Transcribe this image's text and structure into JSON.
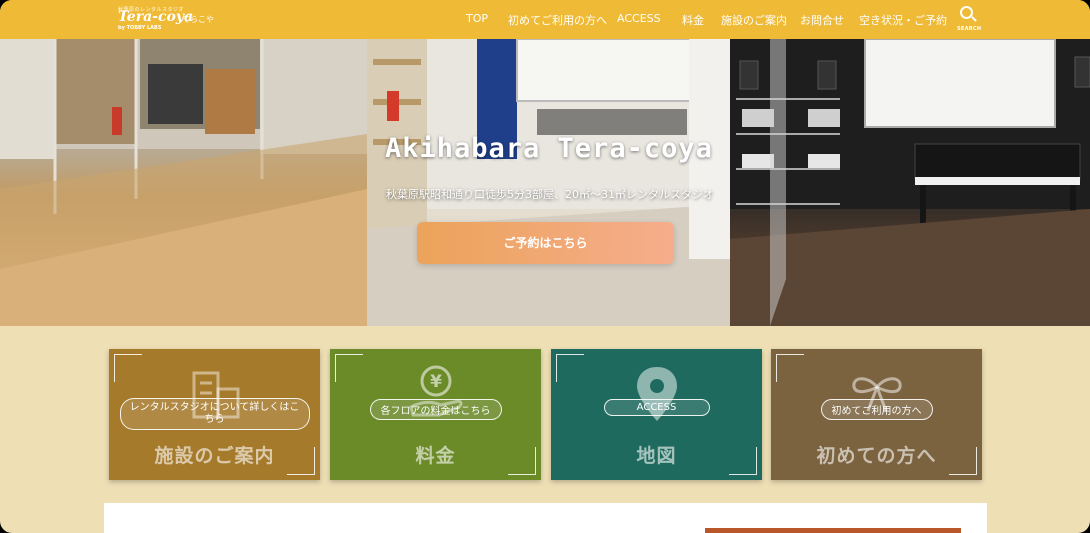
{
  "header": {
    "logo": {
      "tagline": "秋葉原のレンタルスタジオ",
      "name": "Tera-coya",
      "kana": "てらこや",
      "sub": "by TOBBY LABS"
    },
    "nav": [
      "TOP",
      "初めてご利用の方へ",
      "ACCESS",
      "料金",
      "施設のご案内",
      "お問合せ",
      "空き状況・ご予約"
    ],
    "search_label": "SEARCH"
  },
  "hero": {
    "title": "Akihabara Tera-coya",
    "subtitle": "秋葉原駅昭和通り口徒歩5分3部屋、20㎡～31㎡レンタルスタジオ",
    "cta": "ご予約はこちら"
  },
  "cards": [
    {
      "pill": "レンタルスタジオについて詳しくはこちら",
      "title": "施設のご案内",
      "color": "#a67a2b",
      "icon": "building-icon"
    },
    {
      "pill": "各フロアの料金はこちら",
      "title": "料金",
      "color": "#6b8a28",
      "icon": "yen-icon"
    },
    {
      "pill": "ACCESS",
      "title": "地図",
      "color": "#1f6a5e",
      "icon": "map-pin-icon"
    },
    {
      "pill": "初めてご利用の方へ",
      "title": "初めての方へ",
      "color": "#7c6340",
      "icon": "ribbon-icon"
    }
  ],
  "colors": {
    "header_bg": "#efba35",
    "page_bg": "#eedfb5",
    "cta_gradient_start": "#eca35a",
    "cta_gradient_end": "#f6ad8c"
  }
}
